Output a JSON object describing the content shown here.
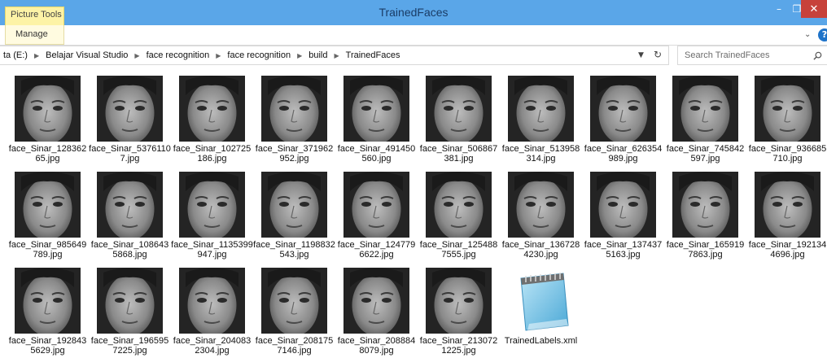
{
  "window": {
    "title": "TrainedFaces",
    "context_tab": "Picture Tools",
    "ribbon_tab": "Manage",
    "controls": {
      "minimize": "–",
      "maximize": "❐",
      "close": "✕"
    }
  },
  "address_bar": {
    "crumbs": [
      "ta (E:)",
      "Belajar Visual Studio",
      "face recognition",
      "face recognition",
      "build",
      "TrainedFaces"
    ]
  },
  "search": {
    "placeholder": "Search TrainedFaces"
  },
  "icons": {
    "separator": "chevron-right-icon",
    "dropdown": "chevron-down-icon",
    "refresh": "refresh-icon",
    "search": "search-icon",
    "help": "help-icon",
    "xml": "notepad-file-icon"
  },
  "colors": {
    "titlebar": "#5aa6e8",
    "context_tab": "#fdf3a6",
    "close_button": "#c7413a"
  },
  "files": [
    {
      "name": "face_Sinar_12836265.jpg",
      "type": "image"
    },
    {
      "name": "face_Sinar_53761107.jpg",
      "type": "image"
    },
    {
      "name": "face_Sinar_102725186.jpg",
      "type": "image"
    },
    {
      "name": "face_Sinar_371962952.jpg",
      "type": "image"
    },
    {
      "name": "face_Sinar_491450560.jpg",
      "type": "image"
    },
    {
      "name": "face_Sinar_506867381.jpg",
      "type": "image"
    },
    {
      "name": "face_Sinar_513958314.jpg",
      "type": "image"
    },
    {
      "name": "face_Sinar_626354989.jpg",
      "type": "image"
    },
    {
      "name": "face_Sinar_745842597.jpg",
      "type": "image"
    },
    {
      "name": "face_Sinar_936685710.jpg",
      "type": "image"
    },
    {
      "name": "face_Sinar_985649789.jpg",
      "type": "image"
    },
    {
      "name": "face_Sinar_1086435868.jpg",
      "type": "image"
    },
    {
      "name": "face_Sinar_1135399947.jpg",
      "type": "image"
    },
    {
      "name": "face_Sinar_1198832543.jpg",
      "type": "image"
    },
    {
      "name": "face_Sinar_1247796622.jpg",
      "type": "image"
    },
    {
      "name": "face_Sinar_1254887555.jpg",
      "type": "image"
    },
    {
      "name": "face_Sinar_1367284230.jpg",
      "type": "image"
    },
    {
      "name": "face_Sinar_1374375163.jpg",
      "type": "image"
    },
    {
      "name": "face_Sinar_1659197863.jpg",
      "type": "image"
    },
    {
      "name": "face_Sinar_1921344696.jpg",
      "type": "image"
    },
    {
      "name": "face_Sinar_1928435629.jpg",
      "type": "image"
    },
    {
      "name": "face_Sinar_1965957225.jpg",
      "type": "image"
    },
    {
      "name": "face_Sinar_2040832304.jpg",
      "type": "image"
    },
    {
      "name": "face_Sinar_2081757146.jpg",
      "type": "image"
    },
    {
      "name": "face_Sinar_2088848079.jpg",
      "type": "image"
    },
    {
      "name": "face_Sinar_2130721225.jpg",
      "type": "image"
    },
    {
      "name": "TrainedLabels.xml",
      "type": "xml"
    }
  ]
}
